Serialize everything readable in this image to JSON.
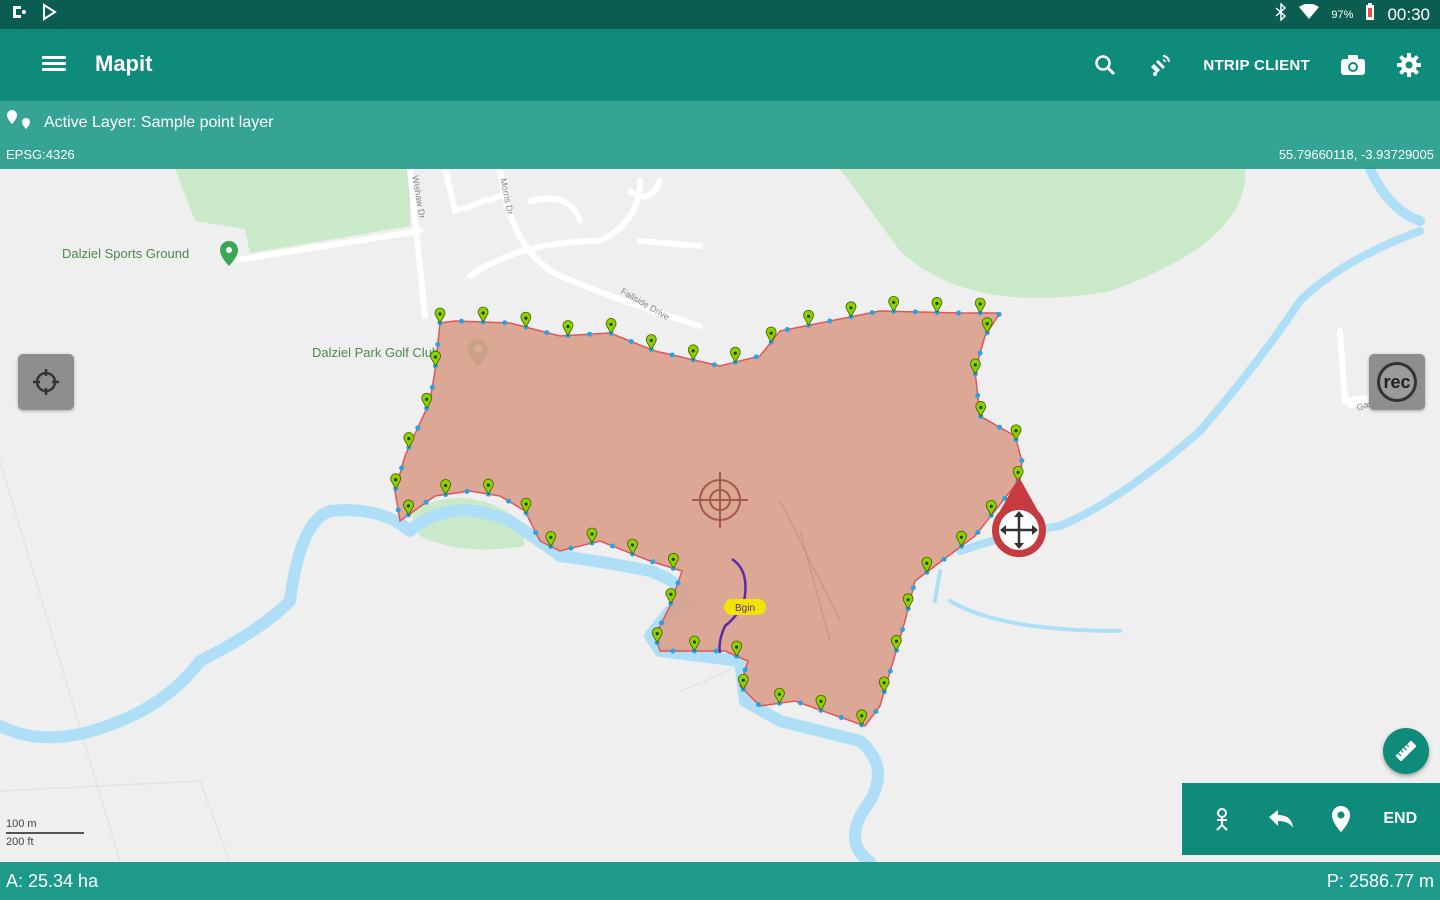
{
  "status_bar": {
    "battery": "97%",
    "time": "00:30"
  },
  "app_bar": {
    "title": "Mapit",
    "ntrip_label": "NTRIP CLIENT"
  },
  "info_bar": {
    "active_layer": "Active Layer: Sample point layer",
    "epsg": "EPSG:4326",
    "coordinates": "55.79660118, -3.93729005"
  },
  "map": {
    "labels": {
      "sports_ground": "Dalziel Sports Ground",
      "golf_club": "Dalziel Park Golf Club",
      "road_a": "Wishaw Dr",
      "road_b": "Morris Dr",
      "road_c": "Fallside Drive",
      "road_d": "Gas Wells"
    },
    "pin_tag": "Bgin",
    "scale_top": "100 m",
    "scale_bottom": "200 ft",
    "colors": {
      "polygon_fill": "#d9a08b",
      "polygon_edge": "#e0555a",
      "vertex": "#2aa3e0",
      "point_marker": "#8cd100",
      "river": "#aedff7",
      "park": "#c9e9c8"
    }
  },
  "edit_bar": {
    "end_label": "END"
  },
  "measurements": {
    "area": "A: 25.34 ha",
    "perimeter": "P: 2586.77 m"
  }
}
